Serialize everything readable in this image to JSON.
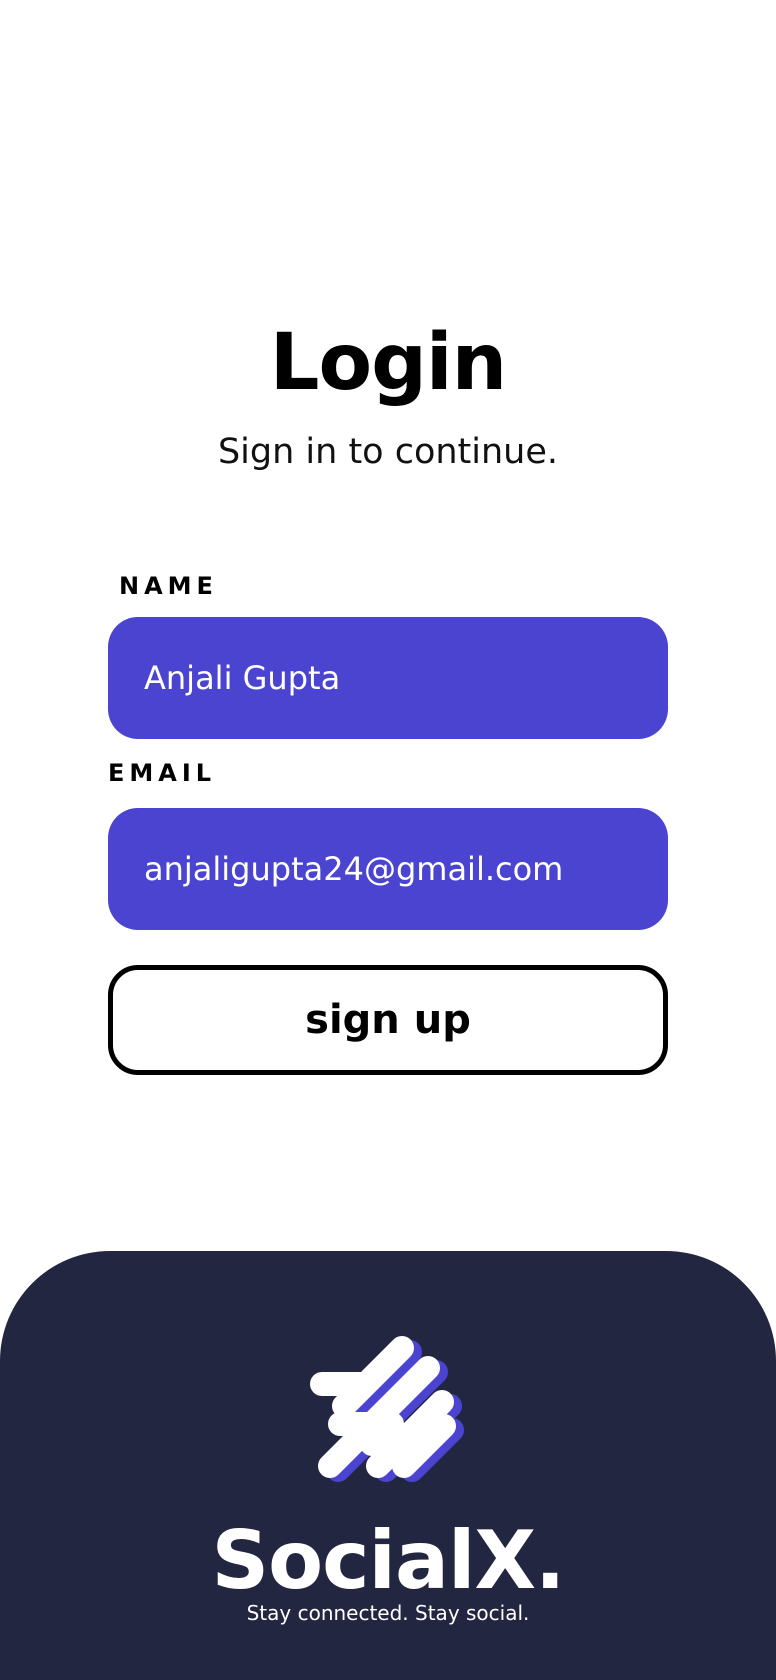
{
  "login": {
    "title": "Login",
    "subtitle": "Sign in to continue."
  },
  "form": {
    "name_label": "NAME",
    "name_value": "Anjali Gupta",
    "email_label": "EMAIL",
    "email_value": "anjaligupta24@gmail.com",
    "signup_label": "sign up"
  },
  "footer": {
    "brand_name": "SocialX.",
    "tagline": "Stay connected. Stay social.",
    "logo_icon": "socialx-logo-icon"
  },
  "colors": {
    "accent": "#4a44d1",
    "footer_bg": "#232640",
    "text": "#000000"
  }
}
